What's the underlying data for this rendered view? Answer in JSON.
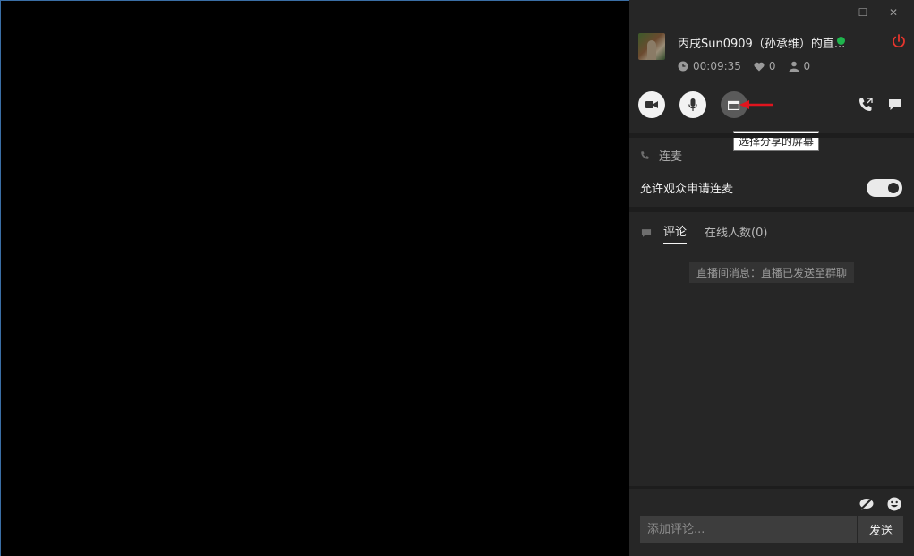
{
  "window": {
    "controls": {
      "minimize": "—",
      "maximize": "☐",
      "close": "✕"
    }
  },
  "host": {
    "name": "丙戌Sun0909（孙承维）的直...",
    "duration": "00:09:35",
    "likes": "0",
    "viewers": "0",
    "live_color": "#1fb54d",
    "power_color": "#e5352d"
  },
  "controls": {
    "camera": "video-camera-icon",
    "mic": "microphone-icon",
    "share": "screen-share-icon",
    "call": "phone-icon",
    "chat": "chat-bubble-icon",
    "tooltip": "选择分享的屏幕",
    "arrow_color": "#e0141e"
  },
  "link_mic": {
    "title": "连麦",
    "allow_label": "允许观众申请连麦",
    "allow_enabled": true
  },
  "comments": {
    "tabs": [
      {
        "label": "评论",
        "active": true
      },
      {
        "label": "在线人数(0)",
        "active": false
      }
    ],
    "system_message": "直播间消息：直播已发送至群聊"
  },
  "composer": {
    "placeholder": "添加评论...",
    "send_label": "发送",
    "mute_icon": "no-comment-icon",
    "emoji_icon": "emoji-icon"
  }
}
